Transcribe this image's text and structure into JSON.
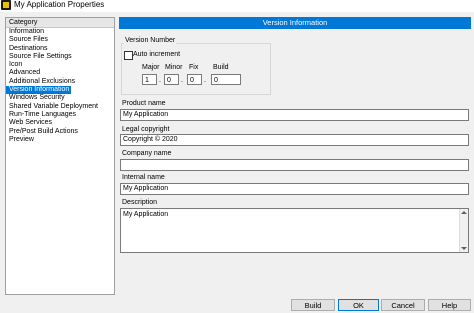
{
  "window": {
    "title": "My Application Properties",
    "icon": "labview-app-icon"
  },
  "category": {
    "header": "Category",
    "items": [
      "Information",
      "Source Files",
      "Destinations",
      "Source File Settings",
      "Icon",
      "Advanced",
      "Additional Exclusions",
      "Version Information",
      "Windows Security",
      "Shared Variable Deployment",
      "Run-Time Languages",
      "Web Services",
      "Pre/Post Build Actions",
      "Preview"
    ],
    "selected_index": 7
  },
  "panel": {
    "header": "Version Information",
    "version_group": {
      "title": "Version Number",
      "auto_increment_label": "Auto increment",
      "auto_increment_checked": false,
      "fields": [
        {
          "label": "Major",
          "value": "1"
        },
        {
          "label": "Minor",
          "value": "0"
        },
        {
          "label": "Fix",
          "value": "0"
        },
        {
          "label": "Build",
          "value": "0"
        }
      ],
      "separator": "."
    },
    "product_name": {
      "label": "Product name",
      "value": "My Application"
    },
    "legal_copyright": {
      "label": "Legal copyright",
      "value": "Copyright © 2020"
    },
    "company_name": {
      "label": "Company name",
      "value": ""
    },
    "internal_name": {
      "label": "Internal name",
      "value": "My Application"
    },
    "description": {
      "label": "Description",
      "value": "My Application"
    }
  },
  "buttons": {
    "build": "Build",
    "ok": "OK",
    "cancel": "Cancel",
    "help": "Help"
  },
  "colors": {
    "accent": "#0078d7",
    "background": "#f0f0f0"
  }
}
